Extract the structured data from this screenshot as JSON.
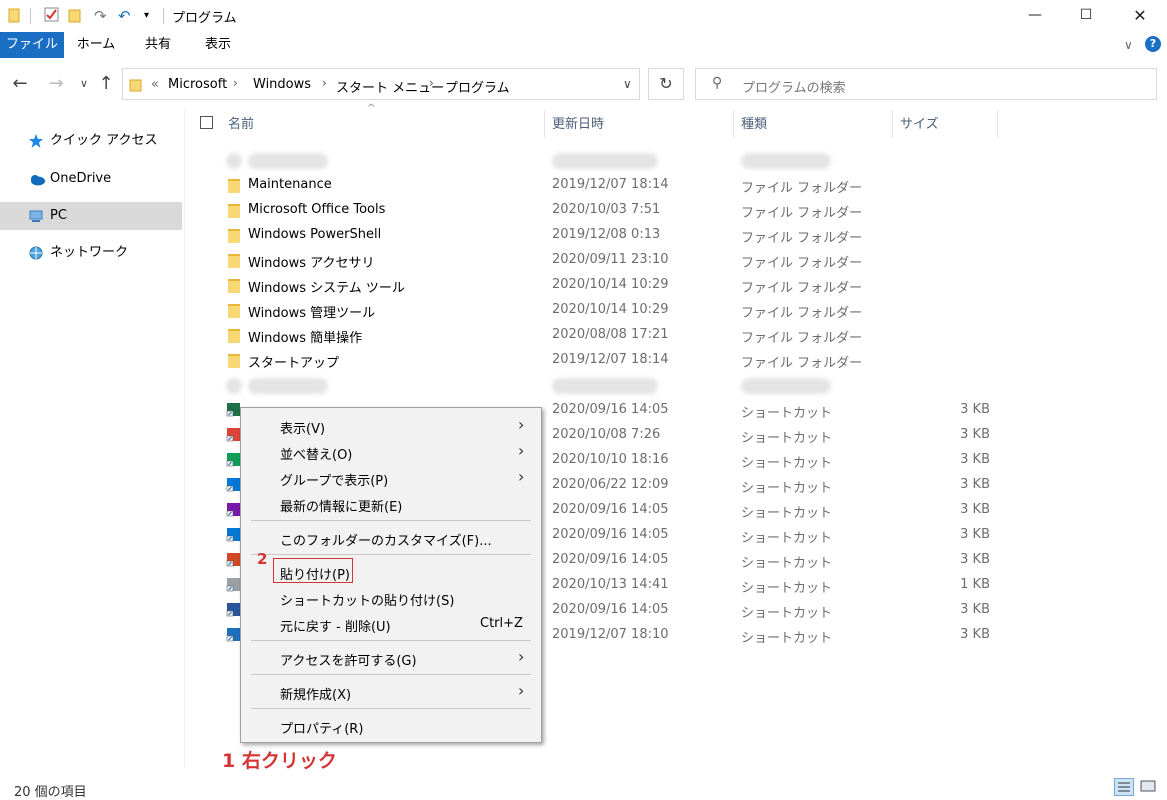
{
  "window": {
    "title": "プログラム"
  },
  "ribbon": {
    "tabs": [
      "ファイル",
      "ホーム",
      "共有",
      "表示"
    ]
  },
  "address": {
    "overflow": "«",
    "crumbs": [
      "Microsoft",
      "Windows",
      "スタート メニュー",
      "プログラム"
    ]
  },
  "search": {
    "placeholder": "プログラムの検索"
  },
  "nav": {
    "items": [
      "クイック アクセス",
      "OneDrive",
      "PC",
      "ネットワーク"
    ]
  },
  "columns": {
    "name": "名前",
    "date": "更新日時",
    "type": "種類",
    "size": "サイズ"
  },
  "files": [
    {
      "name": "",
      "date": "",
      "type": "",
      "size": "",
      "kind": "blurred"
    },
    {
      "name": "Maintenance",
      "date": "2019/12/07 18:14",
      "type": "ファイル フォルダー",
      "size": "",
      "kind": "folder"
    },
    {
      "name": "Microsoft Office Tools",
      "date": "2020/10/03 7:51",
      "type": "ファイル フォルダー",
      "size": "",
      "kind": "folder"
    },
    {
      "name": "Windows PowerShell",
      "date": "2019/12/08 0:13",
      "type": "ファイル フォルダー",
      "size": "",
      "kind": "folder"
    },
    {
      "name": "Windows アクセサリ",
      "date": "2020/09/11 23:10",
      "type": "ファイル フォルダー",
      "size": "",
      "kind": "folder"
    },
    {
      "name": "Windows システム ツール",
      "date": "2020/10/14 10:29",
      "type": "ファイル フォルダー",
      "size": "",
      "kind": "folder"
    },
    {
      "name": "Windows 管理ツール",
      "date": "2020/10/14 10:29",
      "type": "ファイル フォルダー",
      "size": "",
      "kind": "folder"
    },
    {
      "name": "Windows 簡単操作",
      "date": "2020/08/08 17:21",
      "type": "ファイル フォルダー",
      "size": "",
      "kind": "folder"
    },
    {
      "name": "スタートアップ",
      "date": "2019/12/07 18:14",
      "type": "ファイル フォルダー",
      "size": "",
      "kind": "folder"
    },
    {
      "name": "",
      "date": "",
      "type": "",
      "size": "",
      "kind": "blurred"
    },
    {
      "name": "",
      "date": "2020/09/16 14:05",
      "type": "ショートカット",
      "size": "3 KB",
      "kind": "shortcut",
      "color": "#1e7145"
    },
    {
      "name": "",
      "date": "2020/10/08 7:26",
      "type": "ショートカット",
      "size": "3 KB",
      "kind": "shortcut",
      "color": "#db4437"
    },
    {
      "name": "",
      "date": "2020/10/10 18:16",
      "type": "ショートカット",
      "size": "3 KB",
      "kind": "shortcut",
      "color": "#0f9d58"
    },
    {
      "name": "",
      "date": "2020/06/22 12:09",
      "type": "ショートカット",
      "size": "3 KB",
      "kind": "shortcut",
      "color": "#0078d7"
    },
    {
      "name": "",
      "date": "2020/09/16 14:05",
      "type": "ショートカット",
      "size": "3 KB",
      "kind": "shortcut",
      "color": "#7719aa"
    },
    {
      "name": "",
      "date": "2020/09/16 14:05",
      "type": "ショートカット",
      "size": "3 KB",
      "kind": "shortcut",
      "color": "#0078d4"
    },
    {
      "name": "",
      "date": "2020/09/16 14:05",
      "type": "ショートカット",
      "size": "3 KB",
      "kind": "shortcut",
      "color": "#d24726"
    },
    {
      "name": "",
      "date": "2020/10/13 14:41",
      "type": "ショートカット",
      "size": "1 KB",
      "kind": "shortcut",
      "color": "#9aa0a6"
    },
    {
      "name": "",
      "date": "2020/09/16 14:05",
      "type": "ショートカット",
      "size": "3 KB",
      "kind": "shortcut",
      "color": "#2b579a"
    },
    {
      "name": "",
      "date": "2019/12/07 18:10",
      "type": "ショートカット",
      "size": "3 KB",
      "kind": "shortcut",
      "color": "#1f6fbf"
    }
  ],
  "context_menu": {
    "view": "表示(V)",
    "sort": "並べ替え(O)",
    "group": "グループで表示(P)",
    "refresh": "最新の情報に更新(E)",
    "customize": "このフォルダーのカスタマイズ(F)...",
    "paste": "貼り付け(P)",
    "paste_shortcut": "ショートカットの貼り付け(S)",
    "undo": "元に戻す - 削除(U)",
    "undo_shortcut": "Ctrl+Z",
    "access": "アクセスを許可する(G)",
    "new": "新規作成(X)",
    "properties": "プロパティ(R)"
  },
  "annotations": {
    "step1": "1 右クリック",
    "step2": "2"
  },
  "status": {
    "count": "20 個の項目"
  },
  "colors": {
    "accent": "#1a6fc4",
    "annotation": "#d43434",
    "selection": "#d9d9d9"
  }
}
